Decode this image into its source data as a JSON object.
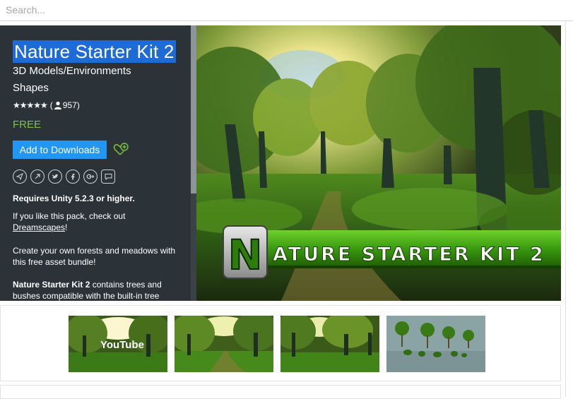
{
  "search": {
    "placeholder": "Search..."
  },
  "asset": {
    "title": "Nature Starter Kit 2",
    "category": "3D Models/Environments",
    "subcategory": "Shapes",
    "stars": "★★★★★",
    "rating_open": "(",
    "rating_count": "957)",
    "price": "FREE",
    "add_button": "Add to Downloads"
  },
  "social": [
    "share-icon",
    "link-icon",
    "twitter-icon",
    "facebook-icon",
    "google-plus-icon",
    "comment-icon"
  ],
  "description": {
    "requires": "Requires Unity 5.2.3 or higher.",
    "check_out": "If you like this pack, check out",
    "link": "Dreamscapes",
    "link_suffix": "!",
    "create": "Create your own forests and meadows with this free asset bundle!",
    "kit_name": "Nature Starter Kit 2",
    "kit_text": " contains trees and bushes compatible with the built-in tree"
  },
  "hero": {
    "banner_letter": "N",
    "banner_text": "ATURE STARTER KIT 2"
  },
  "thumbnails": [
    {
      "name": "thumbnail-video",
      "overlay": "YouTube"
    },
    {
      "name": "thumbnail-forest-path",
      "overlay": ""
    },
    {
      "name": "thumbnail-forest-trees",
      "overlay": ""
    },
    {
      "name": "thumbnail-tree-models",
      "overlay": ""
    }
  ],
  "colors": {
    "panel_bg": "#2b3338",
    "accent_blue": "#2196f3",
    "price_green": "#7cc53c",
    "banner_green": "#3a9a10"
  }
}
